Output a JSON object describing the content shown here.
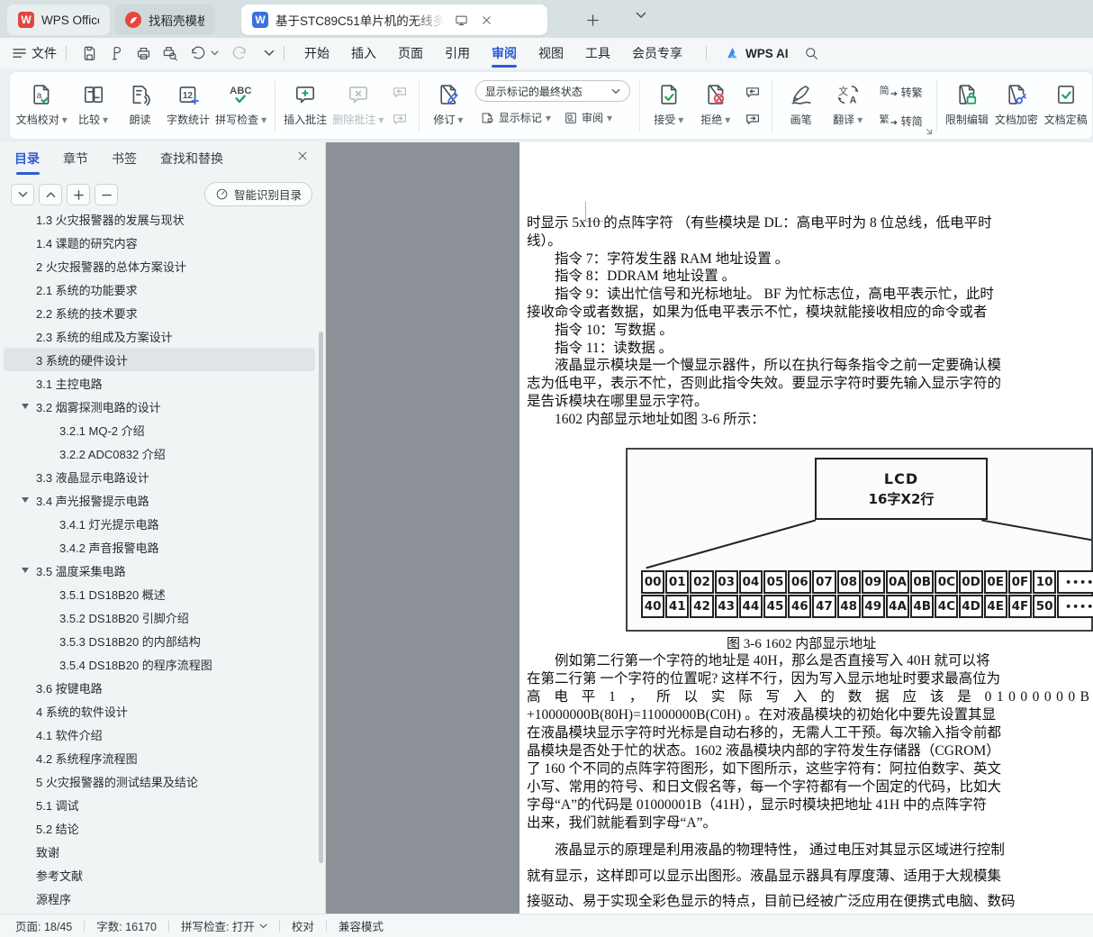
{
  "tabbar": {
    "tab_wps": "WPS Office",
    "tab_docer": "找稻壳模板",
    "tab_doc": "基于STC89C51单片机的无线多",
    "doc_badge_letter": "W",
    "wps_badge_letter": "W"
  },
  "menubar": {
    "file": "文件",
    "items": [
      {
        "label": "开始"
      },
      {
        "label": "插入"
      },
      {
        "label": "页面"
      },
      {
        "label": "引用"
      },
      {
        "label": "审阅",
        "active": true
      },
      {
        "label": "视图"
      },
      {
        "label": "工具"
      },
      {
        "label": "会员专享"
      }
    ],
    "wps_ai": "WPS AI"
  },
  "ribbon": {
    "proofread": "文档校对",
    "compare": "比较",
    "read_aloud": "朗读",
    "word_count": "字数统计",
    "spell_check": "拼写检查",
    "insert_comment": "插入批注",
    "delete_comment": "删除批注",
    "track_changes": "修订",
    "markup_dropdown": "显示标记的最终状态",
    "show_markup": "显示标记",
    "review": "审阅",
    "accept": "接受",
    "reject": "拒绝",
    "pen": "画笔",
    "translate": "翻译",
    "to_traditional": "转繁",
    "to_simplified": "转简",
    "zh_simplified_char": "简",
    "zh_traditional_char": "繁",
    "restrict_edit": "限制编辑",
    "encrypt": "文档加密",
    "finalize": "文档定稿",
    "word_count_icon_text": "12",
    "spell_icon_text": "ABC"
  },
  "sidebar": {
    "tabs": [
      {
        "label": "目录",
        "active": true
      },
      {
        "label": "章节"
      },
      {
        "label": "书签"
      },
      {
        "label": "查找和替换"
      }
    ],
    "smart_toc": "智能识别目录",
    "toc": [
      {
        "label": "1.3 火灾报警器的发展与现状",
        "level": 1
      },
      {
        "label": "1.4 课题的研究内容",
        "level": 1
      },
      {
        "label": "2 火灾报警器的总体方案设计",
        "level": 1
      },
      {
        "label": "2.1 系统的功能要求",
        "level": 1
      },
      {
        "label": "2.2 系统的技术要求",
        "level": 1
      },
      {
        "label": "2.3 系统的组成及方案设计",
        "level": 1
      },
      {
        "label": "3 系统的硬件设计",
        "level": 1,
        "selected": true
      },
      {
        "label": "3.1 主控电路",
        "level": 1
      },
      {
        "label": "3.2 烟雾探测电路的设计",
        "level": 1,
        "expandable": true
      },
      {
        "label": "3.2.1 MQ-2 介绍",
        "level": 2
      },
      {
        "label": "3.2.2 ADC0832 介绍",
        "level": 2
      },
      {
        "label": "3.3 液晶显示电路设计",
        "level": 1
      },
      {
        "label": "3.4 声光报警提示电路",
        "level": 1,
        "expandable": true
      },
      {
        "label": "3.4.1 灯光提示电路",
        "level": 2
      },
      {
        "label": "3.4.2 声音报警电路",
        "level": 2
      },
      {
        "label": "3.5 温度采集电路",
        "level": 1,
        "expandable": true
      },
      {
        "label": "3.5.1 DS18B20 概述",
        "level": 2
      },
      {
        "label": "3.5.2 DS18B20 引脚介绍",
        "level": 2
      },
      {
        "label": "3.5.3 DS18B20 的内部结构",
        "level": 2
      },
      {
        "label": "3.5.4 DS18B20 的程序流程图",
        "level": 2
      },
      {
        "label": "3.6 按键电路",
        "level": 1
      },
      {
        "label": "4 系统的软件设计",
        "level": 1
      },
      {
        "label": "4.1 软件介绍",
        "level": 1
      },
      {
        "label": "4.2 系统程序流程图",
        "level": 1
      },
      {
        "label": "5 火灾报警器的测试结果及结论",
        "level": 1
      },
      {
        "label": "5.1 调试",
        "level": 1
      },
      {
        "label": "5.2 结论",
        "level": 1
      },
      {
        "label": "致谢",
        "level": 1
      },
      {
        "label": "参考文献",
        "level": 1
      },
      {
        "label": "源程序",
        "level": 1
      }
    ]
  },
  "document": {
    "block1": [
      {
        "t": "时显示 5x10 的点阵字符 （有些模块是 DL：高电平时为 8 位总线，低电平时"
      },
      {
        "t": "线）。"
      },
      {
        "t": "指令 7：字符发生器 RAM 地址设置 。",
        "i": true
      },
      {
        "t": "指令 8：DDRAM 地址设置 。",
        "i": true
      },
      {
        "t": "指令 9：读出忙信号和光标地址。 BF 为忙标志位，高电平表示忙，此时",
        "i": true
      },
      {
        "t": "接收命令或者数据，如果为低电平表示不忙，模块就能接收相应的命令或者"
      },
      {
        "t": "指令 10：写数据 。",
        "i": true
      },
      {
        "t": "指令 11：读数据 。",
        "i": true
      },
      {
        "t": "液晶显示模块是一个慢显示器件，所以在执行每条指令之前一定要确认模",
        "i": true
      },
      {
        "t": "志为低电平，表示不忙，否则此指令失效。要显示字符时要先输入显示字符的"
      },
      {
        "t": "是告诉模块在哪里显示字符。"
      },
      {
        "t": "1602 内部显示地址如图 3-6 所示：",
        "i": true
      }
    ],
    "figure": {
      "lcd_line1": "LCD",
      "lcd_line2": "16字X2行",
      "row1": [
        "00",
        "01",
        "02",
        "03",
        "04",
        "05",
        "06",
        "07",
        "08",
        "09",
        "0A",
        "0B",
        "0C",
        "0D",
        "0E",
        "0F",
        "10"
      ],
      "row2": [
        "40",
        "41",
        "42",
        "43",
        "44",
        "45",
        "46",
        "47",
        "48",
        "49",
        "4A",
        "4B",
        "4C",
        "4D",
        "4E",
        "4F",
        "50"
      ],
      "dots": "•••••",
      "caption": "图 3-6 1602 内部显示地址"
    },
    "block2": [
      {
        "t": "例如第二行第一个字符的地址是 40H，那么是否直接写入 40H 就可以将",
        "i": true
      },
      {
        "t": "在第二行第 一个字符的位置呢? 这样不行，因为写入显示地址时要求最高位为"
      },
      {
        "t": "高 电 平 1 ， 所 以 实 际 写 入 的 数 据 应 该 是 01000000B",
        "sp": true
      },
      {
        "t": "+10000000B(80H)=11000000B(C0H) 。在对液晶模块的初始化中要先设置其显"
      },
      {
        "t": "在液晶模块显示字符时光标是自动右移的，无需人工干预。每次输入指令前都"
      },
      {
        "t": "晶模块是否处于忙的状态。1602 液晶模块内部的字符发生存储器（CGROM）"
      },
      {
        "t": "了 160 个不同的点阵字符图形，如下图所示，这些字符有：阿拉伯数字、英文"
      },
      {
        "t": "小写、常用的符号、和日文假名等，每一个字符都有一个固定的代码，比如大"
      },
      {
        "t": "字母“A”的代码是 01000001B（41H），显示时模块把地址 41H 中的点阵字符"
      },
      {
        "t": "出来，我们就能看到字母“A”。"
      }
    ],
    "block3": [
      {
        "t": "液晶显示的原理是利用液晶的物理特性， 通过电压对其显示区域进行控制",
        "i": true
      },
      {
        "t": "就有显示，这样即可以显示出图形。液晶显示器具有厚度薄、适用于大规模集"
      },
      {
        "t": "接驱动、易于实现全彩色显示的特点，目前已经被广泛应用在便携式电脑、数码"
      }
    ]
  },
  "statusbar": {
    "page": "页面: 18/45",
    "words": "字数: 16170",
    "spell": "拼写检查: 打开",
    "proof": "校对",
    "compat": "兼容模式"
  }
}
